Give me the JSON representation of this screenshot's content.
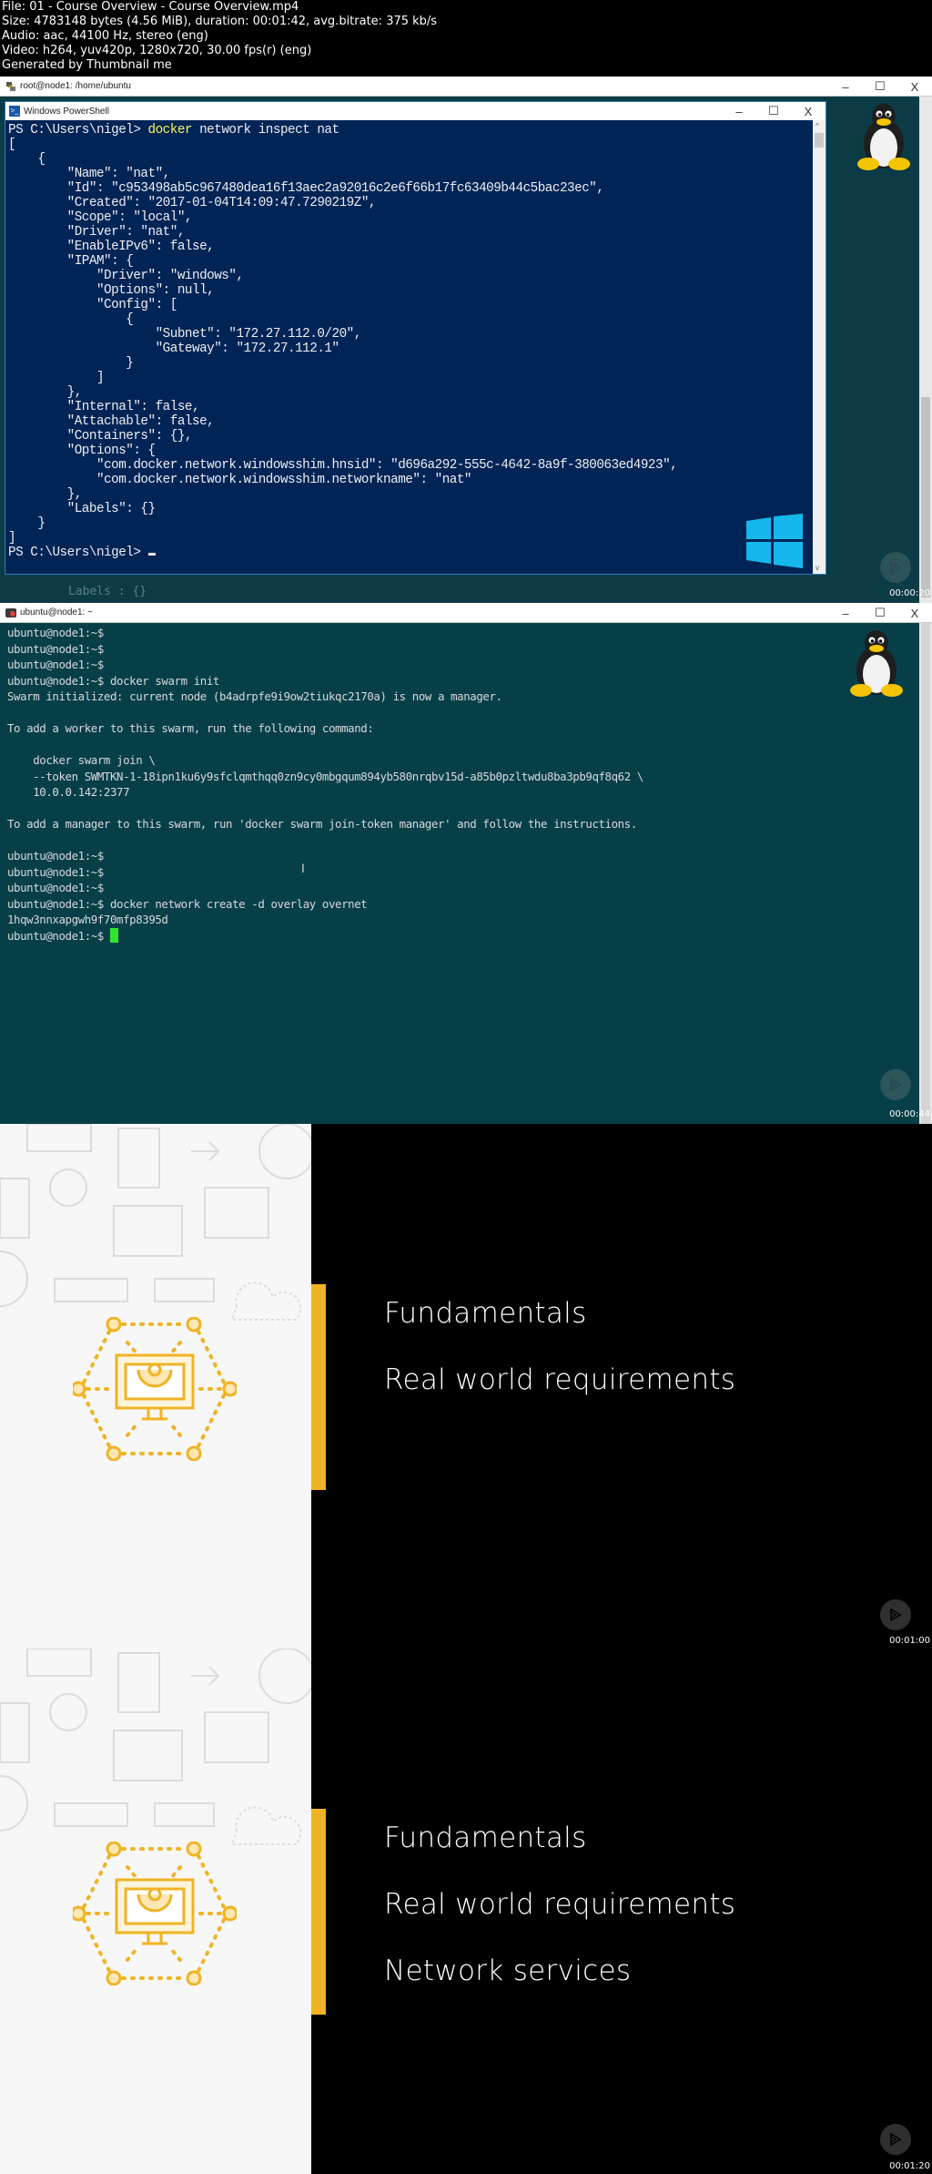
{
  "file_info": {
    "lines": [
      "File: 01 - Course Overview - Course Overview.mp4",
      "Size: 4783148 bytes (4.56 MiB), duration: 00:01:42, avg.bitrate: 375 kb/s",
      "Audio: aac, 44100 Hz, stereo (eng)",
      "Video: h264, yuv420p, 1280x720, 30.00 fps(r) (eng)",
      "Generated by Thumbnail me"
    ]
  },
  "frames": [
    {
      "window_title": "root@node1: /home/ubuntu",
      "controls": {
        "minimize": "–",
        "maximize": "☐",
        "close": "X"
      },
      "powershell": {
        "title": "Windows PowerShell",
        "prompt": "PS C:\\Users\\nigel> ",
        "command_keyword": "docker",
        "command_rest": " network inspect nat",
        "output": "[\n    {\n        \"Name\": \"nat\",\n        \"Id\": \"c953498ab5c967480dea16f13aec2a92016c2e6f66b17fc63409b44c5bac23ec\",\n        \"Created\": \"2017-01-04T14:09:47.7290219Z\",\n        \"Scope\": \"local\",\n        \"Driver\": \"nat\",\n        \"EnableIPv6\": false,\n        \"IPAM\": {\n            \"Driver\": \"windows\",\n            \"Options\": null,\n            \"Config\": [\n                {\n                    \"Subnet\": \"172.27.112.0/20\",\n                    \"Gateway\": \"172.27.112.1\"\n                }\n            ]\n        },\n        \"Internal\": false,\n        \"Attachable\": false,\n        \"Containers\": {},\n        \"Options\": {\n            \"com.docker.network.windowsshim.hnsid\": \"d696a292-555c-4642-8a9f-380063ed4923\",\n            \"com.docker.network.windowsshim.networkname\": \"nat\"\n        },\n        \"Labels\": {}\n    }\n]",
        "final_prompt": "PS C:\\Users\\nigel> "
      },
      "background_text": "Labels : {}",
      "timestamp": "00:00:20"
    },
    {
      "window_title": "ubuntu@node1: ~",
      "controls": {
        "minimize": "–",
        "maximize": "☐",
        "close": "X"
      },
      "terminal_text": "ubuntu@node1:~$\nubuntu@node1:~$\nubuntu@node1:~$\nubuntu@node1:~$ docker swarm init\nSwarm initialized: current node (b4adrpfe9i9ow2tiukqc2170a) is now a manager.\n\nTo add a worker to this swarm, run the following command:\n\n    docker swarm join \\\n    --token SWMTKN-1-18ipn1ku6y9sfclqmthqq0zn9cy0mbgqum894yb580nrqbv15d-a85b0pzltwdu8ba3pb9qf8q62 \\\n    10.0.0.142:2377\n\nTo add a manager to this swarm, run 'docker swarm join-token manager' and follow the instructions.\n\nubuntu@node1:~$\nubuntu@node1:~$\nubuntu@node1:~$\nubuntu@node1:~$ docker network create -d overlay overnet\n1hqw3nnxapgwh9f70mfp8395d\nubuntu@node1:~$ ",
      "timestamp": "00:00:44"
    },
    {
      "items": [
        "Fundamentals",
        "Real world requirements"
      ],
      "timestamp": "00:01:00"
    },
    {
      "items": [
        "Fundamentals",
        "Real world requirements",
        "Network services"
      ],
      "timestamp": "00:01:20"
    }
  ],
  "colors": {
    "accent_yellow": "#f0b323",
    "powershell_bg": "#012456",
    "ubuntu_bg": "#073f49",
    "cursor_green": "#2ee62e"
  }
}
